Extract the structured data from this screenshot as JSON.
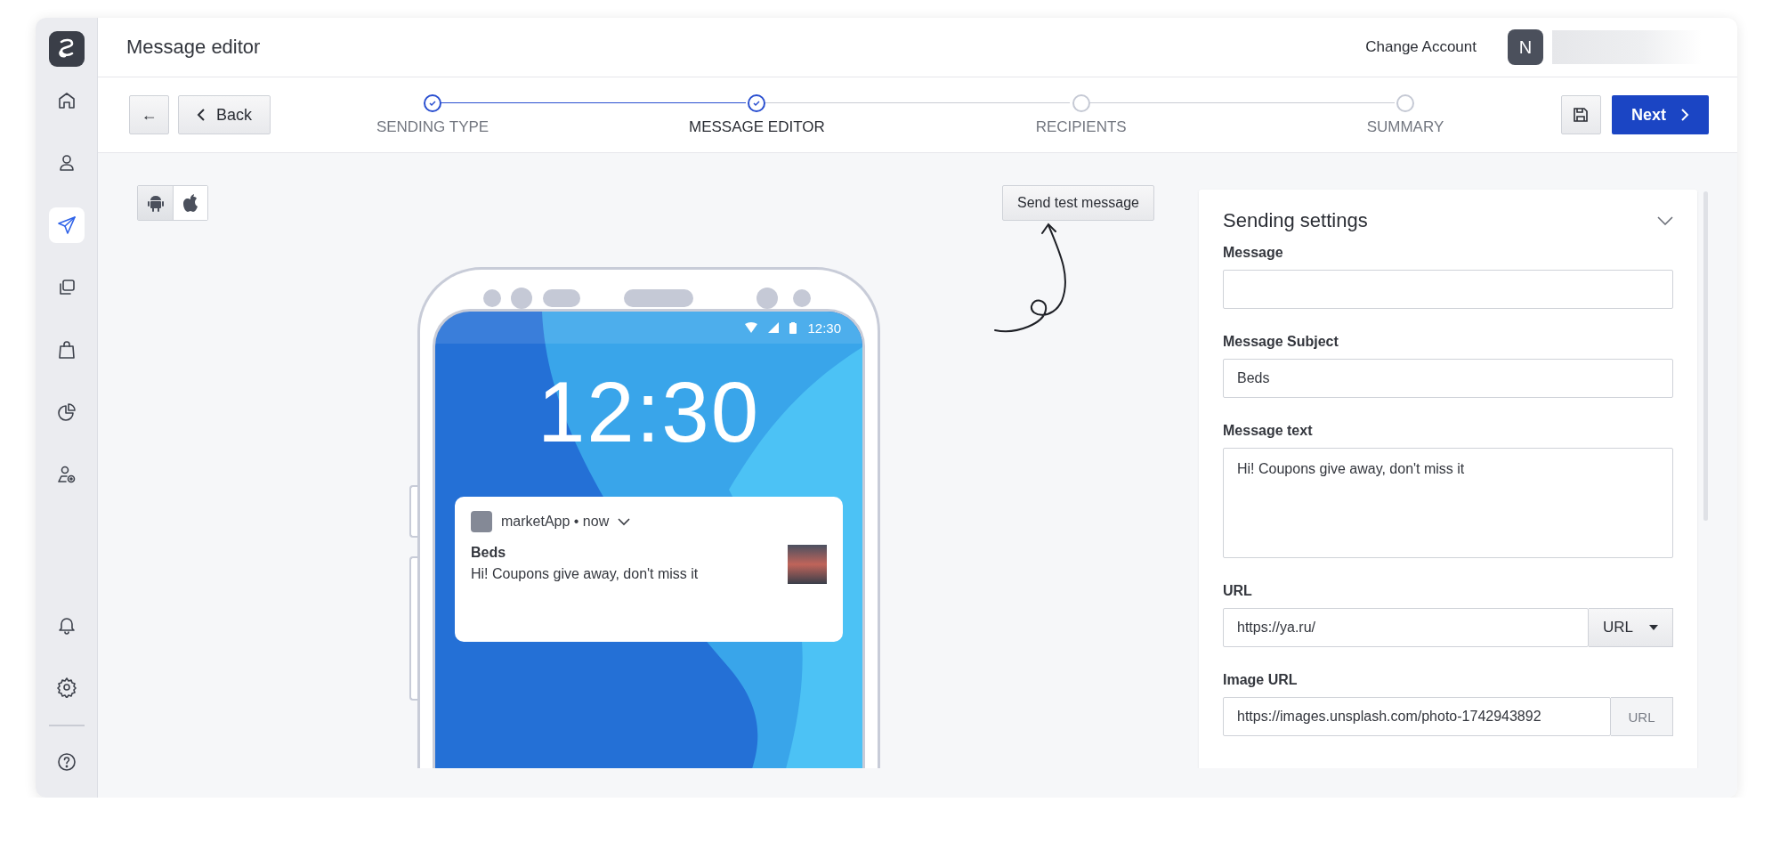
{
  "header": {
    "title": "Message editor",
    "change_account": "Change Account",
    "avatar_initial": "N"
  },
  "sidebar": {
    "items": [
      {
        "kind": "home",
        "selected": false
      },
      {
        "kind": "user",
        "selected": false
      },
      {
        "kind": "send",
        "selected": true
      },
      {
        "kind": "copies",
        "selected": false
      },
      {
        "kind": "bag",
        "selected": false
      },
      {
        "kind": "pie",
        "selected": false
      },
      {
        "kind": "user-gear",
        "selected": false
      }
    ],
    "bottom_items": [
      {
        "kind": "bell",
        "selected": false
      },
      {
        "kind": "gear",
        "selected": false
      }
    ],
    "footer_items": [
      {
        "kind": "help",
        "selected": false
      }
    ]
  },
  "toolbar": {
    "arrow": "←",
    "back": "Back",
    "next": "Next",
    "steps": [
      {
        "label": "SENDING TYPE",
        "done": true
      },
      {
        "label": "MESSAGE EDITOR",
        "done": true
      },
      {
        "label": "RECIPIENTS",
        "done": false
      },
      {
        "label": "SUMMARY",
        "done": false
      }
    ]
  },
  "platforms": [
    {
      "kind": "android",
      "selected": true
    },
    {
      "kind": "apple",
      "selected": false
    }
  ],
  "test_button": "Send test message",
  "preview": {
    "status_time": "12:30",
    "clock": "12:30",
    "app_line": "marketApp • now",
    "title": "Beds",
    "body": "Hi! Coupons give away, don't miss it"
  },
  "settings": {
    "title": "Sending settings",
    "fields": [
      {
        "kind": "input",
        "label": "Message"
      },
      {
        "kind": "input",
        "label": "Message Subject",
        "value": "Beds"
      },
      {
        "kind": "textarea",
        "label": "Message text",
        "value": "Hi! Coupons give away, don't miss it"
      },
      {
        "kind": "select",
        "label": "URL",
        "value": "https://ya.ru/",
        "addon": "URL"
      },
      {
        "kind": "addon",
        "label": "Image URL",
        "value": "https://images.unsplash.com/photo-1742943892",
        "addon": "URL"
      }
    ]
  }
}
